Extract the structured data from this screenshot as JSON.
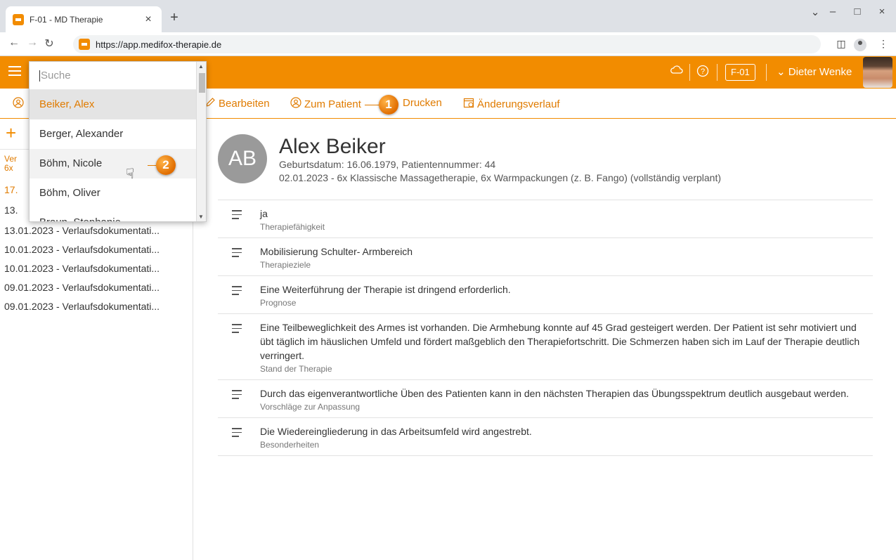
{
  "browser": {
    "tab_title": "F-01 - MD Therapie",
    "tab_close": "×",
    "new_tab": "+",
    "url": "https://app.medifox-therapie.de",
    "win_min": "–",
    "win_max": "□",
    "win_close": "×",
    "win_dropdown": "⌄"
  },
  "header": {
    "location": "F-01",
    "user": "Dieter Wenke",
    "accent_color": "#f28c00"
  },
  "actions": {
    "edit": "Bearbeiten",
    "to_patient": "Zum Patient",
    "print": "Drucken",
    "history": "Änderungsverlauf"
  },
  "callouts": {
    "one": "1",
    "two": "2"
  },
  "dropdown": {
    "placeholder": "Suche",
    "items": [
      "Beiker, Alex",
      "Berger, Alexander",
      "Böhm, Nicole",
      "Böhm, Oliver",
      "Braun, Stephanie"
    ]
  },
  "left_panel": {
    "head_line1": "Ver",
    "head_line2": "6x",
    "items": [
      "17.",
      "13.",
      "13.01.2023 - Verlaufsdokumentati...",
      "10.01.2023 - Verlaufsdokumentati...",
      "10.01.2023 - Verlaufsdokumentati...",
      "09.01.2023 - Verlaufsdokumentati...",
      "09.01.2023 - Verlaufsdokumentati..."
    ]
  },
  "patient": {
    "initials": "AB",
    "name": "Alex Beiker",
    "meta1": "Geburtsdatum: 16.06.1979, Patientennummer: 44",
    "meta2": "02.01.2023 - 6x Klassische Massagetherapie, 6x Warmpackungen (z. B. Fango) (vollständig verplant)"
  },
  "entries": [
    {
      "value": "ja",
      "label": "Therapiefähigkeit"
    },
    {
      "value": "Mobilisierung Schulter- Armbereich",
      "label": "Therapieziele"
    },
    {
      "value": "Eine Weiterführung der Therapie ist dringend erforderlich.",
      "label": "Prognose"
    },
    {
      "value": "Eine Teilbeweglichkeit des Armes ist vorhanden. Die Armhebung konnte auf 45 Grad gesteigert werden. Der Patient ist sehr motiviert und übt täglich im häuslichen Umfeld und fördert maßgeblich den Therapiefortschritt. Die Schmerzen haben sich im Lauf der Therapie deutlich verringert.",
      "label": "Stand der Therapie"
    },
    {
      "value": "Durch das eigenverantwortliche Üben des Patienten kann in den nächsten Therapien das Übungsspektrum deutlich ausgebaut werden.",
      "label": "Vorschläge zur Anpassung"
    },
    {
      "value": "Die Wiedereingliederung in das Arbeitsumfeld wird angestrebt.",
      "label": "Besonderheiten"
    }
  ]
}
